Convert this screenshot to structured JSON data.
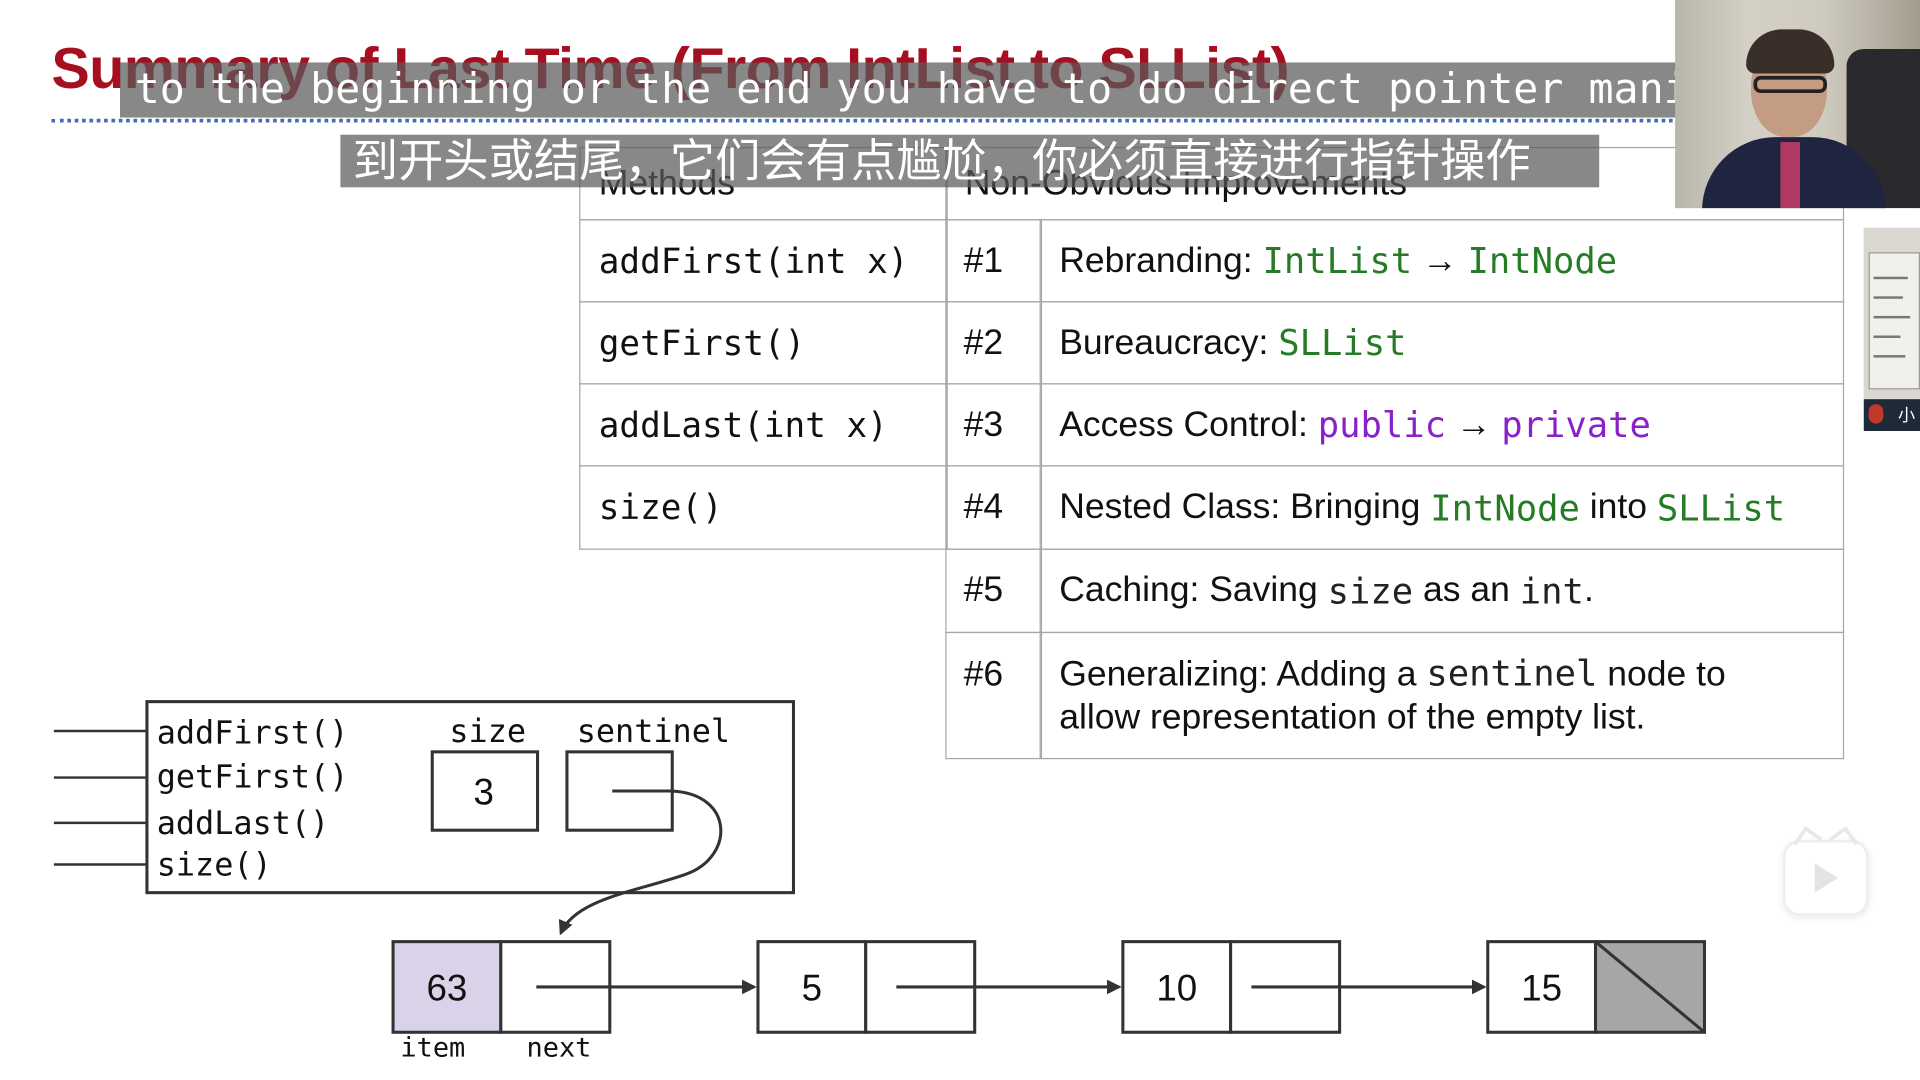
{
  "slide": {
    "title": "Summary of Last Time (From IntList to SLList)"
  },
  "subtitles": {
    "english": "to the beginning or the end you have to do direct pointer manipulation",
    "chinese": "到开头或结尾，它们会有点尴尬，你必须直接进行指针操作"
  },
  "table": {
    "header_methods": "Methods",
    "header_improvements": "Non-Obvious Improvements",
    "methods": [
      "addFirst(int x)",
      "getFirst()",
      "addLast(int x)",
      "size()"
    ],
    "improvements": [
      {
        "num": "#1",
        "label": "Rebranding: ",
        "code1": "IntList",
        "arrow": " → ",
        "code2": "IntNode"
      },
      {
        "num": "#2",
        "label": "Bureaucracy: ",
        "code1": "SLList"
      },
      {
        "num": "#3",
        "label": "Access Control: ",
        "code1": "public",
        "arrow": " → ",
        "code2": "private"
      },
      {
        "num": "#4",
        "label": "Nested Class: Bringing ",
        "code1": "IntNode",
        "mid": " into ",
        "code2": "SLList"
      },
      {
        "num": "#5",
        "pre": "Caching: Saving ",
        "code1": "size",
        "mid": " as an ",
        "code2": "int",
        "post": "."
      },
      {
        "num": "#6",
        "pre": "Generalizing: Adding a ",
        "code1": "sentinel",
        "post": " node to",
        "line2": "allow representation of the empty list."
      }
    ]
  },
  "diagram": {
    "methods": [
      "addFirst()",
      "getFirst()",
      "addLast()",
      "size()"
    ],
    "size_label": "size",
    "sentinel_label": "sentinel",
    "size_value": "3",
    "nodes": [
      "63",
      "5",
      "10",
      "15"
    ],
    "item_label": "item",
    "next_label": "next",
    "colors": {
      "sentinel_item_fill": "#d9d2e9",
      "null_fill": "#a6a6a6"
    }
  },
  "video": {
    "participant_name": "小"
  },
  "icons": {
    "play": "play-icon",
    "mic": "mic-muted-icon"
  }
}
